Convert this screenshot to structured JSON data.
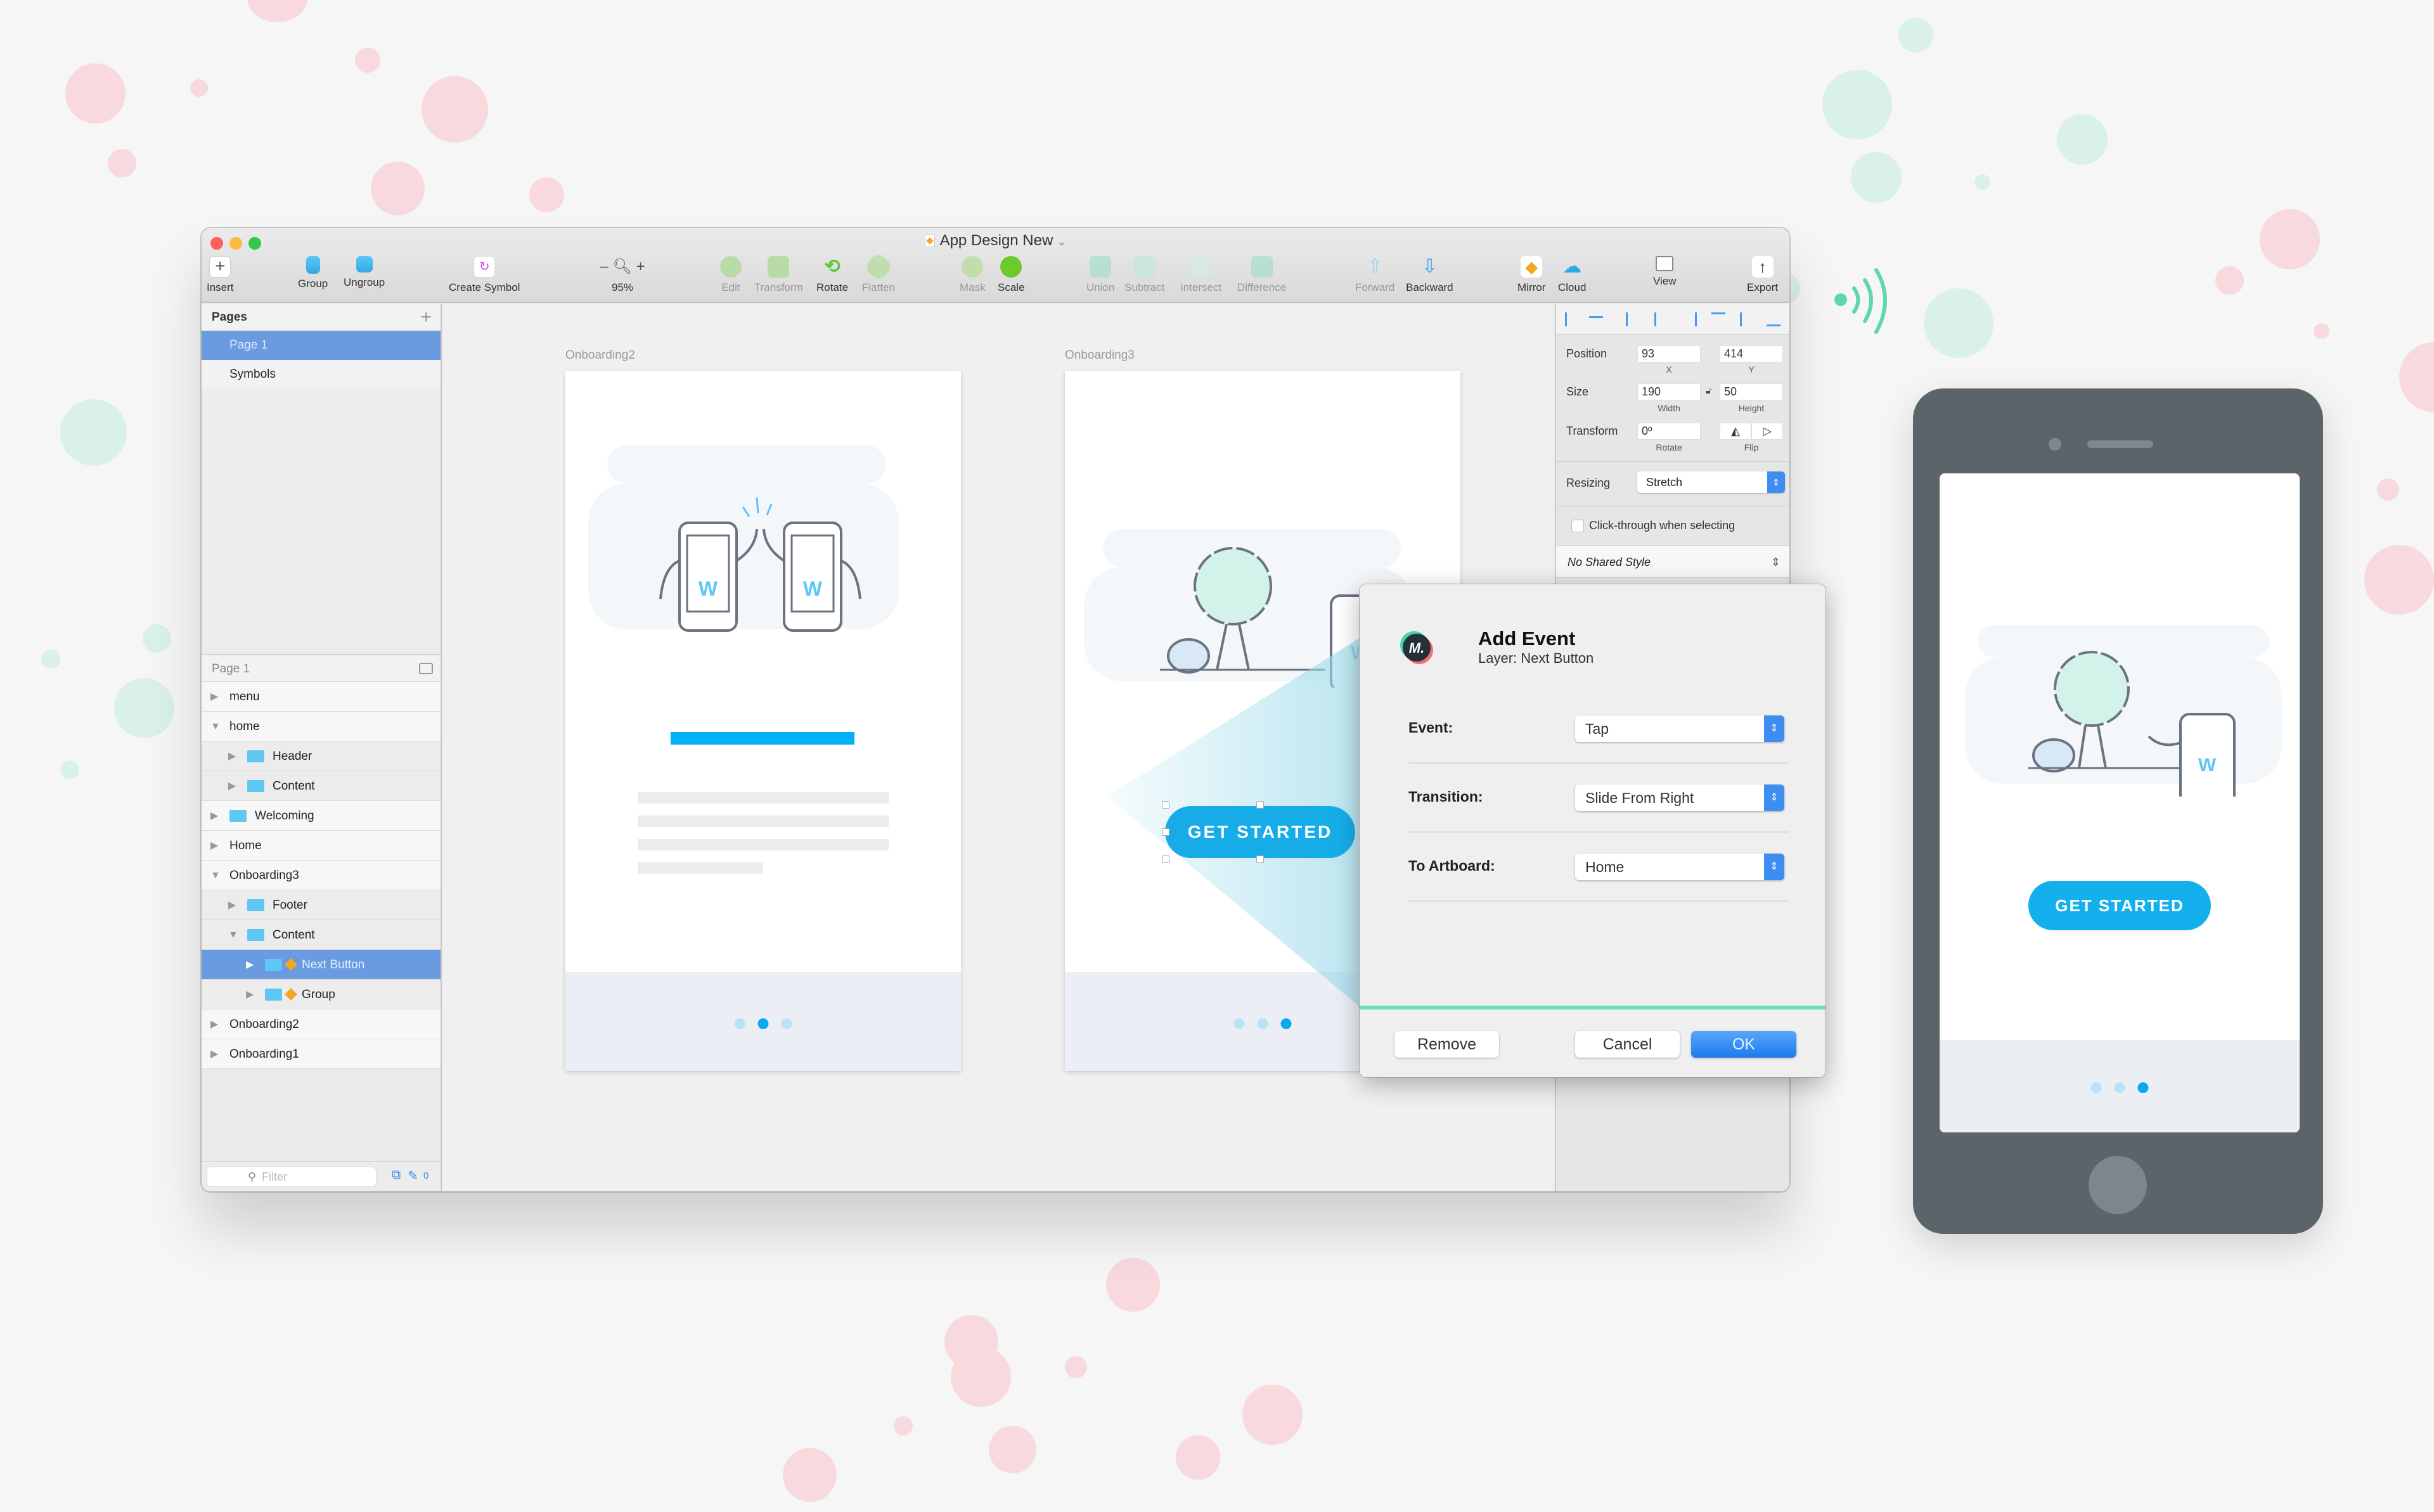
{
  "window": {
    "title": "App Design New",
    "traffic_lights": [
      {
        "name": "close",
        "color": "#fc605c"
      },
      {
        "name": "minimize",
        "color": "#fdbc40"
      },
      {
        "name": "zoom",
        "color": "#34c84a"
      }
    ]
  },
  "toolbar": {
    "insert": "Insert",
    "group": "Group",
    "ungroup": "Ungroup",
    "create_symbol": "Create Symbol",
    "zoom_level": "95%",
    "zoom_minus": "–",
    "zoom_plus": "+",
    "edit": "Edit",
    "transform": "Transform",
    "rotate": "Rotate",
    "flatten": "Flatten",
    "mask": "Mask",
    "scale": "Scale",
    "union": "Union",
    "subtract": "Subtract",
    "intersect": "Intersect",
    "difference": "Difference",
    "forward": "Forward",
    "backward": "Backward",
    "mirror": "Mirror",
    "cloud": "Cloud",
    "view": "View",
    "export": "Export"
  },
  "pages": {
    "header": "Pages",
    "add": "+",
    "items": [
      {
        "label": "Page 1",
        "selected": true
      },
      {
        "label": "Symbols",
        "selected": false
      }
    ]
  },
  "layers": {
    "header": "Page 1",
    "items": [
      {
        "label": "menu",
        "depth": 0,
        "expanded": false,
        "folder": false,
        "symbol": false,
        "selected": false
      },
      {
        "label": "home",
        "depth": 0,
        "expanded": true,
        "folder": false,
        "symbol": false,
        "selected": false
      },
      {
        "label": "Header",
        "depth": 1,
        "expanded": false,
        "folder": true,
        "symbol": false,
        "selected": false
      },
      {
        "label": "Content",
        "depth": 1,
        "expanded": false,
        "folder": true,
        "symbol": false,
        "selected": false
      },
      {
        "label": "Welcoming",
        "depth": 0,
        "expanded": false,
        "folder": true,
        "symbol": false,
        "selected": false
      },
      {
        "label": "Home",
        "depth": 0,
        "expanded": false,
        "folder": false,
        "symbol": false,
        "selected": false
      },
      {
        "label": "Onboarding3",
        "depth": 0,
        "expanded": true,
        "folder": false,
        "symbol": false,
        "selected": false
      },
      {
        "label": "Footer",
        "depth": 1,
        "expanded": false,
        "folder": true,
        "symbol": false,
        "selected": false
      },
      {
        "label": "Content",
        "depth": 1,
        "expanded": true,
        "folder": true,
        "symbol": false,
        "selected": false
      },
      {
        "label": "Next Button",
        "depth": 2,
        "expanded": false,
        "folder": true,
        "symbol": true,
        "selected": true
      },
      {
        "label": "Group",
        "depth": 2,
        "expanded": false,
        "folder": true,
        "symbol": true,
        "selected": false
      },
      {
        "label": "Onboarding2",
        "depth": 0,
        "expanded": false,
        "folder": false,
        "symbol": false,
        "selected": false
      },
      {
        "label": "Onboarding1",
        "depth": 0,
        "expanded": false,
        "folder": false,
        "symbol": false,
        "selected": false
      }
    ],
    "filter_placeholder": "Filter",
    "footer_count": "0"
  },
  "canvas": {
    "artboards": [
      {
        "label": "Onboarding2",
        "page_dots": 3,
        "active_dot": 2
      },
      {
        "label": "Onboarding3",
        "page_dots": 3,
        "active_dot": 3,
        "button_label": "GET STARTED"
      }
    ]
  },
  "inspector": {
    "position_label": "Position",
    "x": "93",
    "y": "414",
    "x_label": "X",
    "y_label": "Y",
    "size_label": "Size",
    "width": "190",
    "height": "50",
    "width_label": "Width",
    "height_label": "Height",
    "transform_label": "Transform",
    "rotate": "0º",
    "rotate_label": "Rotate",
    "flip_label": "Flip",
    "resizing_label": "Resizing",
    "resizing_value": "Stretch",
    "click_through_label": "Click-through when selecting",
    "click_through_checked": false,
    "shared_style": "No Shared Style"
  },
  "dialog": {
    "title": "Add Event",
    "subtitle": "Layer: Next Button",
    "fields": [
      {
        "label": "Event:",
        "value": "Tap"
      },
      {
        "label": "Transition:",
        "value": "Slide From Right"
      },
      {
        "label": "To Artboard:",
        "value": "Home"
      }
    ],
    "remove": "Remove",
    "cancel": "Cancel",
    "ok": "OK",
    "accent_color": "#6fdcc0"
  },
  "preview_phone": {
    "button_label": "GET STARTED",
    "page_dots": 3,
    "active_dot": 3,
    "accent_color": "#14b0ee"
  },
  "colors": {
    "selection": "#6a9be0",
    "primary_blue": "#09a9ef",
    "mint": "#5fd6b0"
  }
}
